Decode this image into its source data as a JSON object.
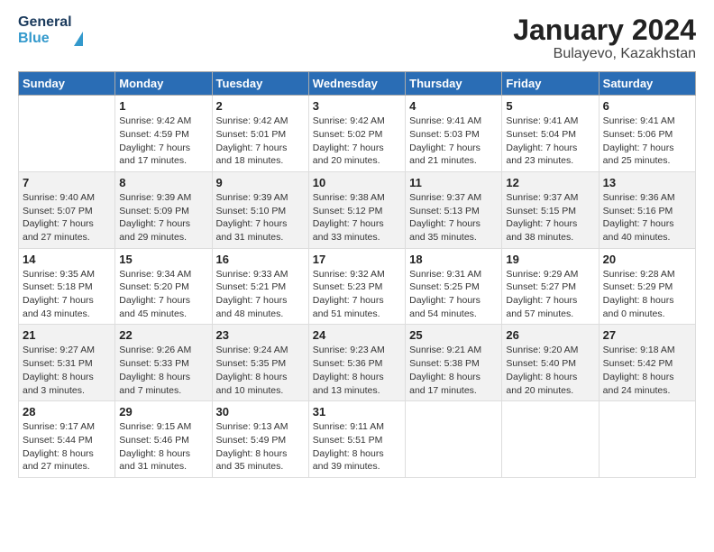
{
  "header": {
    "logo_line1": "General",
    "logo_line2": "Blue",
    "month": "January 2024",
    "location": "Bulayevo, Kazakhstan"
  },
  "weekdays": [
    "Sunday",
    "Monday",
    "Tuesday",
    "Wednesday",
    "Thursday",
    "Friday",
    "Saturday"
  ],
  "weeks": [
    [
      {
        "day": "",
        "sunrise": "",
        "sunset": "",
        "daylight": ""
      },
      {
        "day": "1",
        "sunrise": "Sunrise: 9:42 AM",
        "sunset": "Sunset: 4:59 PM",
        "daylight": "Daylight: 7 hours and 17 minutes."
      },
      {
        "day": "2",
        "sunrise": "Sunrise: 9:42 AM",
        "sunset": "Sunset: 5:01 PM",
        "daylight": "Daylight: 7 hours and 18 minutes."
      },
      {
        "day": "3",
        "sunrise": "Sunrise: 9:42 AM",
        "sunset": "Sunset: 5:02 PM",
        "daylight": "Daylight: 7 hours and 20 minutes."
      },
      {
        "day": "4",
        "sunrise": "Sunrise: 9:41 AM",
        "sunset": "Sunset: 5:03 PM",
        "daylight": "Daylight: 7 hours and 21 minutes."
      },
      {
        "day": "5",
        "sunrise": "Sunrise: 9:41 AM",
        "sunset": "Sunset: 5:04 PM",
        "daylight": "Daylight: 7 hours and 23 minutes."
      },
      {
        "day": "6",
        "sunrise": "Sunrise: 9:41 AM",
        "sunset": "Sunset: 5:06 PM",
        "daylight": "Daylight: 7 hours and 25 minutes."
      }
    ],
    [
      {
        "day": "7",
        "sunrise": "Sunrise: 9:40 AM",
        "sunset": "Sunset: 5:07 PM",
        "daylight": "Daylight: 7 hours and 27 minutes."
      },
      {
        "day": "8",
        "sunrise": "Sunrise: 9:39 AM",
        "sunset": "Sunset: 5:09 PM",
        "daylight": "Daylight: 7 hours and 29 minutes."
      },
      {
        "day": "9",
        "sunrise": "Sunrise: 9:39 AM",
        "sunset": "Sunset: 5:10 PM",
        "daylight": "Daylight: 7 hours and 31 minutes."
      },
      {
        "day": "10",
        "sunrise": "Sunrise: 9:38 AM",
        "sunset": "Sunset: 5:12 PM",
        "daylight": "Daylight: 7 hours and 33 minutes."
      },
      {
        "day": "11",
        "sunrise": "Sunrise: 9:37 AM",
        "sunset": "Sunset: 5:13 PM",
        "daylight": "Daylight: 7 hours and 35 minutes."
      },
      {
        "day": "12",
        "sunrise": "Sunrise: 9:37 AM",
        "sunset": "Sunset: 5:15 PM",
        "daylight": "Daylight: 7 hours and 38 minutes."
      },
      {
        "day": "13",
        "sunrise": "Sunrise: 9:36 AM",
        "sunset": "Sunset: 5:16 PM",
        "daylight": "Daylight: 7 hours and 40 minutes."
      }
    ],
    [
      {
        "day": "14",
        "sunrise": "Sunrise: 9:35 AM",
        "sunset": "Sunset: 5:18 PM",
        "daylight": "Daylight: 7 hours and 43 minutes."
      },
      {
        "day": "15",
        "sunrise": "Sunrise: 9:34 AM",
        "sunset": "Sunset: 5:20 PM",
        "daylight": "Daylight: 7 hours and 45 minutes."
      },
      {
        "day": "16",
        "sunrise": "Sunrise: 9:33 AM",
        "sunset": "Sunset: 5:21 PM",
        "daylight": "Daylight: 7 hours and 48 minutes."
      },
      {
        "day": "17",
        "sunrise": "Sunrise: 9:32 AM",
        "sunset": "Sunset: 5:23 PM",
        "daylight": "Daylight: 7 hours and 51 minutes."
      },
      {
        "day": "18",
        "sunrise": "Sunrise: 9:31 AM",
        "sunset": "Sunset: 5:25 PM",
        "daylight": "Daylight: 7 hours and 54 minutes."
      },
      {
        "day": "19",
        "sunrise": "Sunrise: 9:29 AM",
        "sunset": "Sunset: 5:27 PM",
        "daylight": "Daylight: 7 hours and 57 minutes."
      },
      {
        "day": "20",
        "sunrise": "Sunrise: 9:28 AM",
        "sunset": "Sunset: 5:29 PM",
        "daylight": "Daylight: 8 hours and 0 minutes."
      }
    ],
    [
      {
        "day": "21",
        "sunrise": "Sunrise: 9:27 AM",
        "sunset": "Sunset: 5:31 PM",
        "daylight": "Daylight: 8 hours and 3 minutes."
      },
      {
        "day": "22",
        "sunrise": "Sunrise: 9:26 AM",
        "sunset": "Sunset: 5:33 PM",
        "daylight": "Daylight: 8 hours and 7 minutes."
      },
      {
        "day": "23",
        "sunrise": "Sunrise: 9:24 AM",
        "sunset": "Sunset: 5:35 PM",
        "daylight": "Daylight: 8 hours and 10 minutes."
      },
      {
        "day": "24",
        "sunrise": "Sunrise: 9:23 AM",
        "sunset": "Sunset: 5:36 PM",
        "daylight": "Daylight: 8 hours and 13 minutes."
      },
      {
        "day": "25",
        "sunrise": "Sunrise: 9:21 AM",
        "sunset": "Sunset: 5:38 PM",
        "daylight": "Daylight: 8 hours and 17 minutes."
      },
      {
        "day": "26",
        "sunrise": "Sunrise: 9:20 AM",
        "sunset": "Sunset: 5:40 PM",
        "daylight": "Daylight: 8 hours and 20 minutes."
      },
      {
        "day": "27",
        "sunrise": "Sunrise: 9:18 AM",
        "sunset": "Sunset: 5:42 PM",
        "daylight": "Daylight: 8 hours and 24 minutes."
      }
    ],
    [
      {
        "day": "28",
        "sunrise": "Sunrise: 9:17 AM",
        "sunset": "Sunset: 5:44 PM",
        "daylight": "Daylight: 8 hours and 27 minutes."
      },
      {
        "day": "29",
        "sunrise": "Sunrise: 9:15 AM",
        "sunset": "Sunset: 5:46 PM",
        "daylight": "Daylight: 8 hours and 31 minutes."
      },
      {
        "day": "30",
        "sunrise": "Sunrise: 9:13 AM",
        "sunset": "Sunset: 5:49 PM",
        "daylight": "Daylight: 8 hours and 35 minutes."
      },
      {
        "day": "31",
        "sunrise": "Sunrise: 9:11 AM",
        "sunset": "Sunset: 5:51 PM",
        "daylight": "Daylight: 8 hours and 39 minutes."
      },
      {
        "day": "",
        "sunrise": "",
        "sunset": "",
        "daylight": ""
      },
      {
        "day": "",
        "sunrise": "",
        "sunset": "",
        "daylight": ""
      },
      {
        "day": "",
        "sunrise": "",
        "sunset": "",
        "daylight": ""
      }
    ]
  ]
}
